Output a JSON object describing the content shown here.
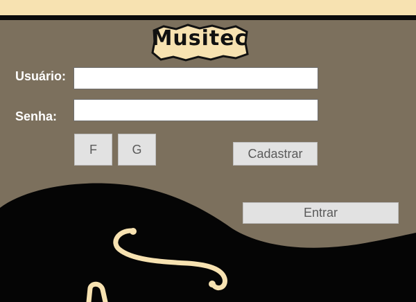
{
  "app": {
    "logo_text": "Musitec"
  },
  "form": {
    "username_label": "Usuário:",
    "password_label": "Senha:",
    "username_value": "",
    "password_value": ""
  },
  "buttons": {
    "facebook_label": "F",
    "google_label": "G",
    "register_label": "Cadastrar",
    "login_label": "Entrar"
  },
  "colors": {
    "background": "#7c705d",
    "accent": "#f7e2b1",
    "guitar_body": "#050505",
    "button_bg": "#e2e2e2"
  }
}
